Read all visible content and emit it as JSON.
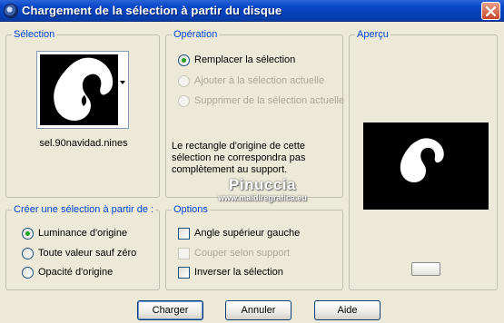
{
  "window": {
    "title": "Chargement de la sélection à partir du disque",
    "close_icon": "close-icon"
  },
  "selection": {
    "legend": "Sélection",
    "filename": "sel.90navidad.nines"
  },
  "operation": {
    "legend": "Opération",
    "options": [
      {
        "label": "Remplacer la sélection",
        "checked": true,
        "enabled": true
      },
      {
        "label": "Ajouter à la sélection actuelle",
        "checked": false,
        "enabled": false
      },
      {
        "label": "Supprimer de la sélection actuelle",
        "checked": false,
        "enabled": false
      }
    ],
    "note": "Le rectangle d'origine de cette sélection ne correspondra pas complètement au support."
  },
  "preview": {
    "legend": "Aperçu"
  },
  "create": {
    "legend": "Créer une sélection à partir de :",
    "options": [
      {
        "label": "Luminance d'origine",
        "checked": true
      },
      {
        "label": "Toute valeur sauf zéro",
        "checked": false
      },
      {
        "label": "Opacité d'origine",
        "checked": false
      }
    ]
  },
  "options": {
    "legend": "Options",
    "items": [
      {
        "label": "Angle supérieur gauche",
        "checked": false,
        "enabled": true
      },
      {
        "label": "Couper selon support",
        "checked": false,
        "enabled": false
      },
      {
        "label": "Inverser la sélection",
        "checked": false,
        "enabled": true
      }
    ]
  },
  "watermark": {
    "line1": "Pinuccia",
    "line2": "www.maidiregrafica.eu"
  },
  "buttons": {
    "load": "Charger",
    "cancel": "Annuler",
    "help": "Aide"
  },
  "colors": {
    "title_bar": "#0a48c8",
    "legend_text": "#0046d5",
    "dialog_bg": "#ece9d8",
    "radio_dot": "#21a121"
  }
}
